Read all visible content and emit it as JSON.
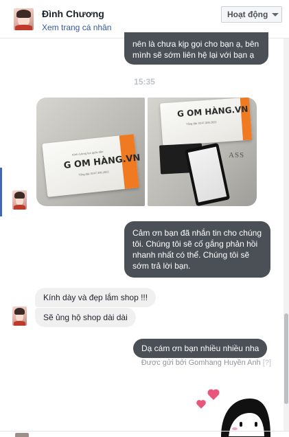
{
  "header": {
    "name": "Đình Chương",
    "profile_link": "Xem trang cá nhân",
    "status_button": "Hoạt động"
  },
  "messages": {
    "out_1_line1": "nên là chưa kịp gọi cho bạn ạ, bên",
    "out_1_line2": "mình sẽ sớm liên hệ lại với bạn ạ",
    "timestamp": "15:35",
    "photo_left": {
      "logo": "G OM HÀNG.VN",
      "tagline": "Kính cường lực quốc dân",
      "phone": "Tổng đài: 0247.308.2822"
    },
    "photo_right": {
      "logo": "G OM HÀNG.VN",
      "phone": "Tổng đài: 0247.308.2822",
      "glass": "ASS"
    },
    "out_2": "Cảm ơn bạn đã nhắn tin cho chúng tôi. Chúng tôi sẽ cố gắng phản hồi nhanh nhất có thể. Chúng tôi sẽ sớm trả lời bạn.",
    "in_1": "Kính dày và đẹp lắm shop !!!",
    "in_2": "Sẽ ủng hộ shop dài dài",
    "out_3": "Dạ cám ơn bạn nhiều nhiều nha",
    "sent_by": "Được gửi bởi Gomhang Huyền Anh",
    "sent_by_help": "[?]"
  },
  "colors": {
    "outgoing_bubble": "#4b4f56",
    "incoming_bubble": "#f1f0f0",
    "link": "#365899",
    "accent": "#4267b2",
    "box_stripe": "#f07a21"
  },
  "icons": {
    "caret": "chevron-down-icon",
    "sticker": "girl-with-hearts-sticker"
  }
}
